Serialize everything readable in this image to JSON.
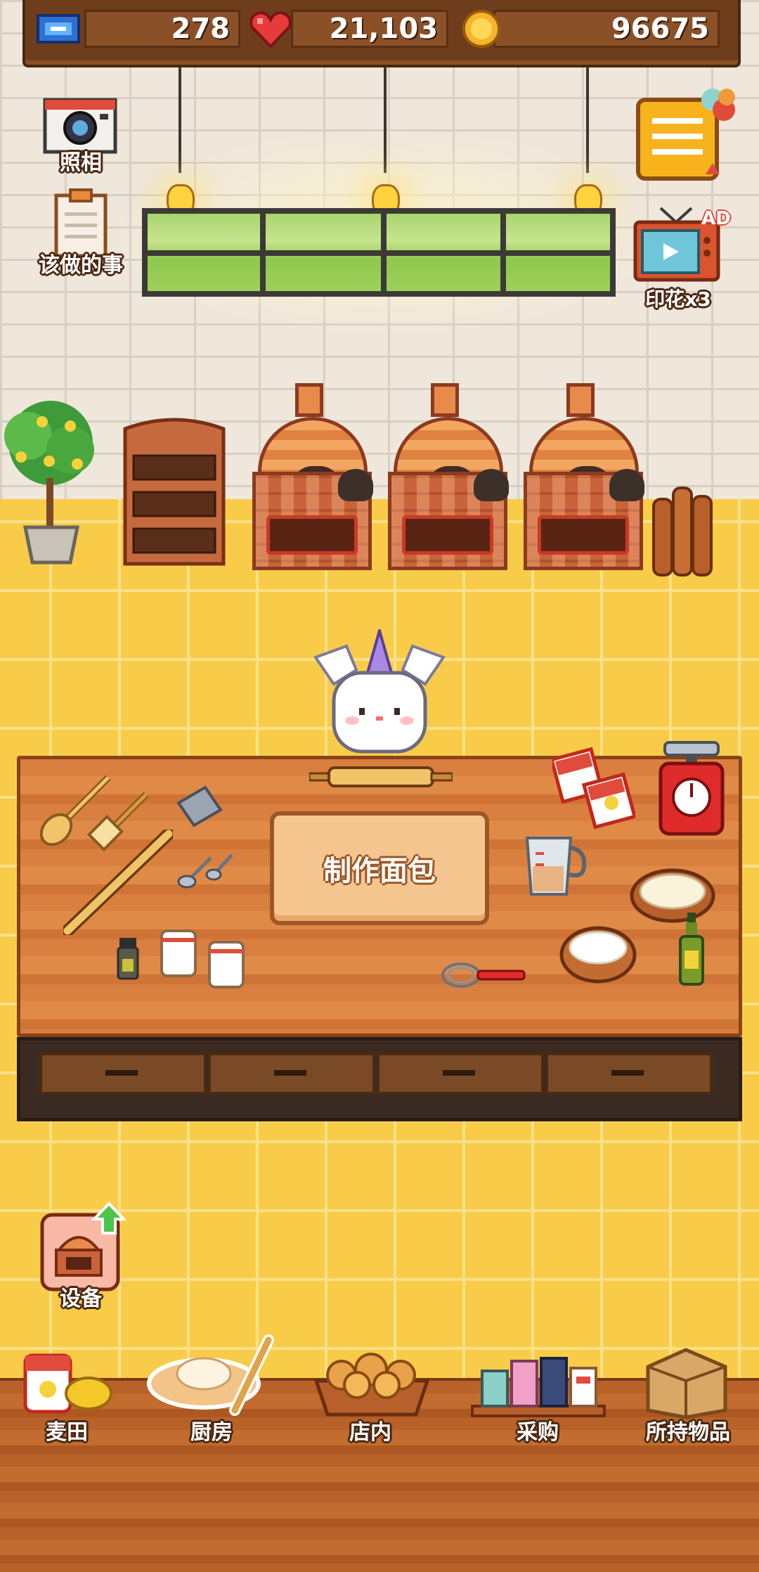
{
  "stats": {
    "tickets": "278",
    "hearts": "21,103",
    "coins": "96675"
  },
  "left_buttons": {
    "camera_label": "照相",
    "todo_label": "该做的事",
    "equipment_label": "设备"
  },
  "right_buttons": {
    "ad_badge": "AD",
    "stamp_label": "印花x3"
  },
  "table": {
    "make_bread_label": "制作面包"
  },
  "bottom_nav": [
    {
      "label": "麦田",
      "icon": "wheat-field-icon"
    },
    {
      "label": "厨房",
      "icon": "kitchen-icon"
    },
    {
      "label": "店内",
      "icon": "shop-interior-icon"
    },
    {
      "label": "采购",
      "icon": "purchase-icon"
    },
    {
      "label": "所持物品",
      "icon": "inventory-icon"
    }
  ],
  "colors": {
    "floor": "#f8cc48",
    "wood_dark": "#6e3d1c",
    "oven_brick": "#c9643a",
    "accent_red": "#e63b3b",
    "coin_gold": "#f6b52a"
  }
}
